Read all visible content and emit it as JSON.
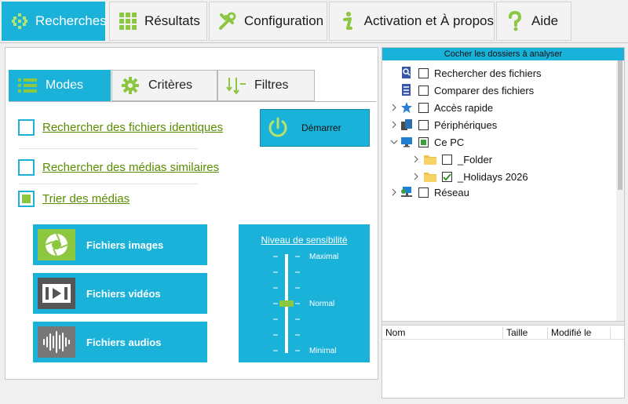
{
  "top_tabs": [
    {
      "label": "Recherches",
      "icon": "dots-grid-icon"
    },
    {
      "label": "Résultats",
      "icon": "grid-icon"
    },
    {
      "label": "Configuration",
      "icon": "tools-icon"
    },
    {
      "label": "Activation et À propos",
      "icon": "info-icon"
    },
    {
      "label": "Aide",
      "icon": "help-icon"
    }
  ],
  "sub_tabs": [
    {
      "label": "Modes",
      "icon": "list-icon"
    },
    {
      "label": "Critères",
      "icon": "gear-icon"
    },
    {
      "label": "Filtres",
      "icon": "filter-arrows-icon"
    }
  ],
  "modes": [
    {
      "label": "Rechercher des fichiers identiques",
      "checked": false
    },
    {
      "label": "Rechercher des médias similaires",
      "checked": false
    },
    {
      "label": "Trier des médias",
      "checked": true
    }
  ],
  "start_button": {
    "label": "Démarrer"
  },
  "media_buttons": [
    {
      "label": "Fichiers images",
      "icon": "aperture-icon"
    },
    {
      "label": "Fichiers vidéos",
      "icon": "video-play-icon"
    },
    {
      "label": "Fichiers audios",
      "icon": "audio-wave-icon"
    }
  ],
  "sensitivity": {
    "title": "Niveau de sensibilité",
    "max_label": "Maximal",
    "mid_label": "Normal",
    "min_label": "Minimal",
    "level": 0.5
  },
  "folders_panel": {
    "header": "Cocher les dossiers à analyser",
    "tree": [
      {
        "label": "Rechercher des fichiers",
        "level": 0,
        "expander": "",
        "icon": "search-file-icon",
        "checked": false
      },
      {
        "label": "Comparer des fichiers",
        "level": 0,
        "expander": "",
        "icon": "compare-file-icon",
        "checked": false
      },
      {
        "label": "Accès rapide",
        "level": 0,
        "expander": ">",
        "icon": "star-icon",
        "checked": false
      },
      {
        "label": "Périphériques",
        "level": 0,
        "expander": ">",
        "icon": "devices-icon",
        "checked": false
      },
      {
        "label": "Ce PC",
        "level": 0,
        "expander": "v",
        "icon": "monitor-icon",
        "checked": "partial"
      },
      {
        "label": "_Folder",
        "level": 1,
        "expander": ">",
        "icon": "folder-icon",
        "checked": false
      },
      {
        "label": "_Holidays 2026",
        "level": 1,
        "expander": ">",
        "icon": "folder-icon",
        "checked": true
      },
      {
        "label": "Réseau",
        "level": 0,
        "expander": ">",
        "icon": "network-icon",
        "checked": false
      }
    ],
    "columns": [
      "Nom",
      "Taille",
      "Modifié le"
    ]
  }
}
